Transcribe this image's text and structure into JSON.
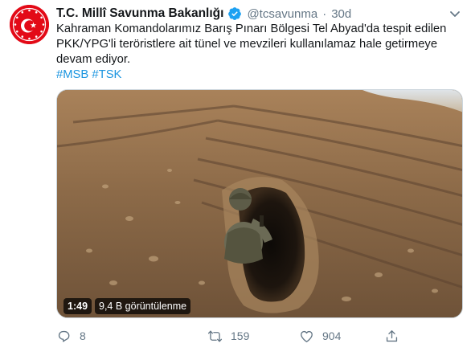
{
  "tweet": {
    "display_name": "T.C. Millî Savunma Bakanlığı",
    "handle": "@tcsavunma",
    "separator": "·",
    "time": "30d",
    "text_lines": [
      "Kahraman Komandolarımız Barış Pınarı Bölgesi Tel Abyad'da tespit edilen",
      "PKK/YPG'li teröristlere ait tünel ve mevzileri kullanılamaz hale getirmeye",
      "devam ediyor."
    ],
    "hashtags": [
      "#MSB",
      "#TSK"
    ],
    "avatar_icon": "turkish-flag-star-crescent-emblem-icon",
    "verified_icon": "verified-badge-icon",
    "more_icon": "chevron-down-icon"
  },
  "video": {
    "duration": "1:49",
    "views": "9,4 B görüntülenme"
  },
  "actions": {
    "reply": {
      "icon": "reply-icon",
      "count": "8"
    },
    "retweet": {
      "icon": "retweet-icon",
      "count": "159"
    },
    "like": {
      "icon": "heart-icon",
      "count": "904"
    },
    "share": {
      "icon": "share-icon"
    }
  },
  "colors": {
    "text": "#14171a",
    "secondary": "#657786",
    "link": "#1b95e0",
    "verified": "#1da1f2",
    "brand_red": "#e30a17"
  }
}
